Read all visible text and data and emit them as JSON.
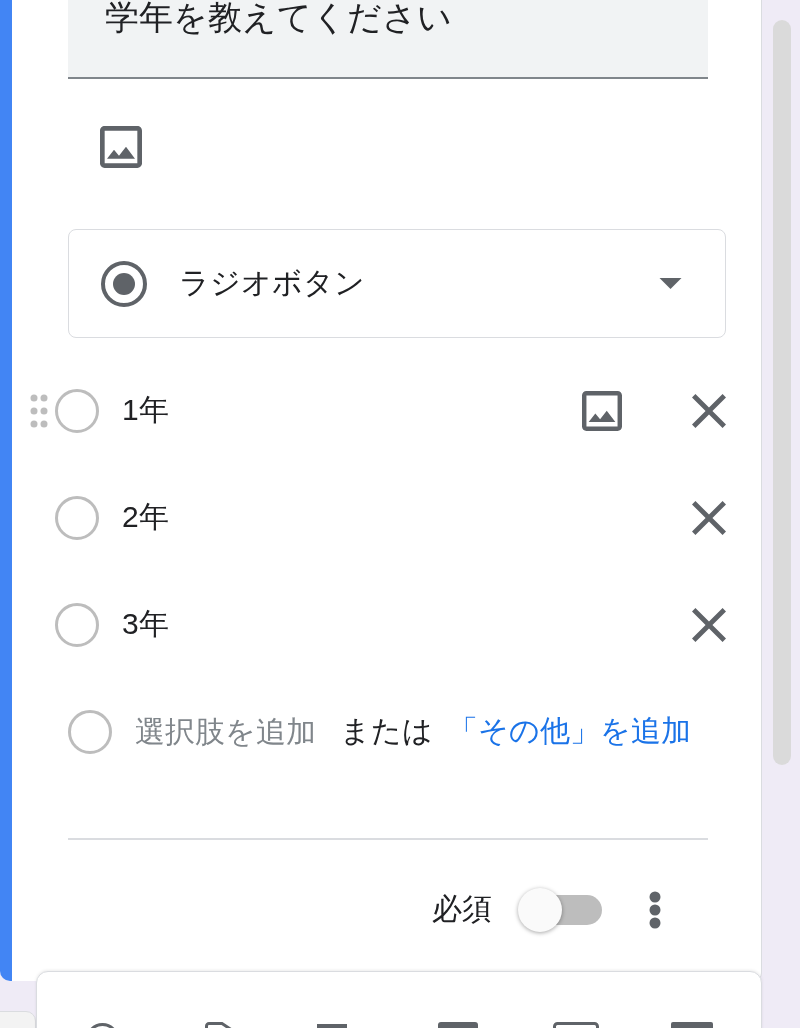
{
  "question": {
    "title": "学年を教えてください"
  },
  "type_select": {
    "label": "ラジオボタン"
  },
  "options": [
    {
      "label": "1年",
      "hovered": true
    },
    {
      "label": "2年",
      "hovered": false
    },
    {
      "label": "3年",
      "hovered": false
    }
  ],
  "add_option": {
    "placeholder": "選択肢を追加",
    "separator": "または",
    "add_other": "「その他」を追加"
  },
  "footer": {
    "required_label": "必須",
    "required": false
  }
}
